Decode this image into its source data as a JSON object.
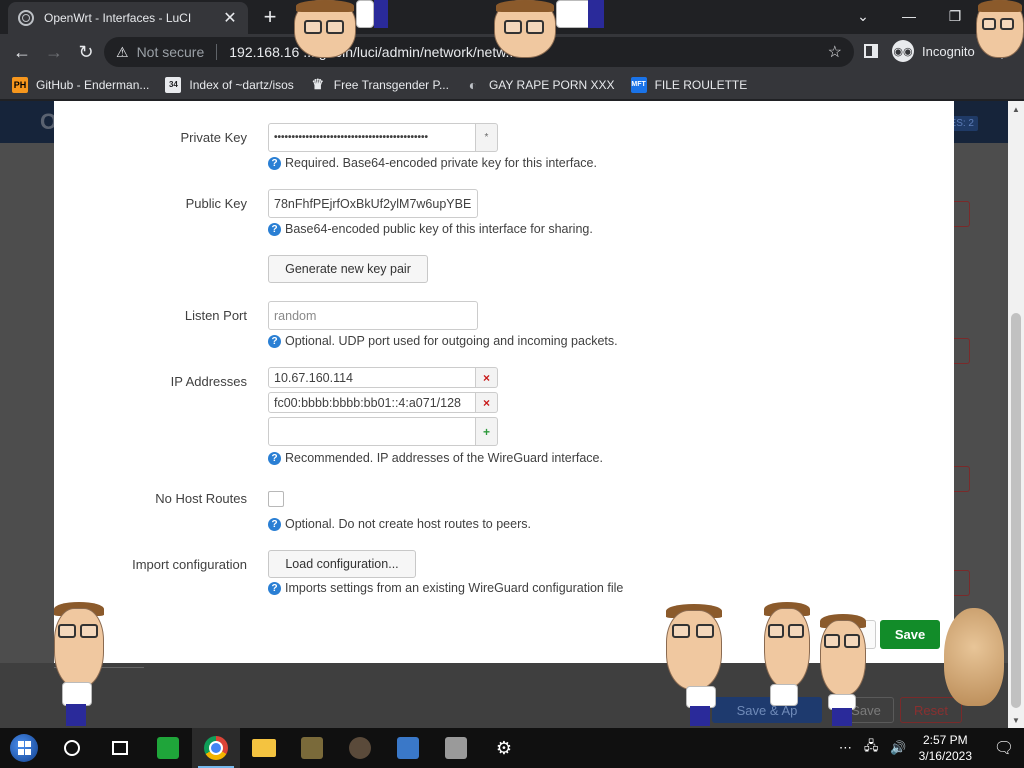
{
  "browser": {
    "tab_title": "OpenWrt - Interfaces - LuCI",
    "tab_close": "✕",
    "new_tab": "+",
    "win_min": "—",
    "win_max": "❐",
    "win_close": "✕",
    "win_menu": "⌄",
    "not_secure": "Not secure",
    "url": "192.168.16 ... gi-bin/luci/admin/network/netw...",
    "incognito": "Incognito"
  },
  "bookmarks": [
    {
      "label": "GitHub - Enderman...",
      "icon": "PH"
    },
    {
      "label": "Index of ~dartz/isos",
      "icon": "34"
    },
    {
      "label": "Free Transgender P...",
      "icon": "hat-icon"
    },
    {
      "label": "GAY RAPE PORN XXX",
      "icon": "globe-icon"
    },
    {
      "label": "FILE ROULETTE",
      "icon": "MFT"
    }
  ],
  "form": {
    "private_key": {
      "label": "Private Key",
      "value": "••••••••••••••••••••••••••••••••••••••••••••",
      "reveal": "*",
      "help": "Required. Base64-encoded private key for this interface."
    },
    "public_key": {
      "label": "Public Key",
      "value": "78nFhfPEjrfOxBkUf2ylM7w6upYBE",
      "help": "Base64-encoded public key of this interface for sharing."
    },
    "generate_button": "Generate new key pair",
    "listen_port": {
      "label": "Listen Port",
      "placeholder": "random",
      "help": "Optional. UDP port used for outgoing and incoming packets."
    },
    "ip_addresses": {
      "label": "IP Addresses",
      "values": [
        "10.67.160.114",
        "fc00:bbbb:bbbb:bb01::4:a071/128"
      ],
      "remove": "×",
      "add": "+",
      "help": "Recommended. IP addresses of the WireGuard interface."
    },
    "no_host_routes": {
      "label": "No Host Routes",
      "checked": false,
      "help": "Optional. Do not create host routes to peers."
    },
    "import_config": {
      "label": "Import configuration",
      "button": "Load configuration...",
      "help": "Imports settings from an existing WireGuard configuration file"
    },
    "save_button": "Save"
  },
  "background": {
    "badge": "ES: 2",
    "save_apply": "Save & Ap",
    "save": "Save",
    "reset": "Reset"
  },
  "taskbar": {
    "time": "2:57 PM",
    "date": "3/16/2023"
  },
  "colors": {
    "save_green": "#128c29",
    "help_blue": "#2a7fd4",
    "remove_red": "#c81919",
    "add_green": "#2e9a3c"
  }
}
